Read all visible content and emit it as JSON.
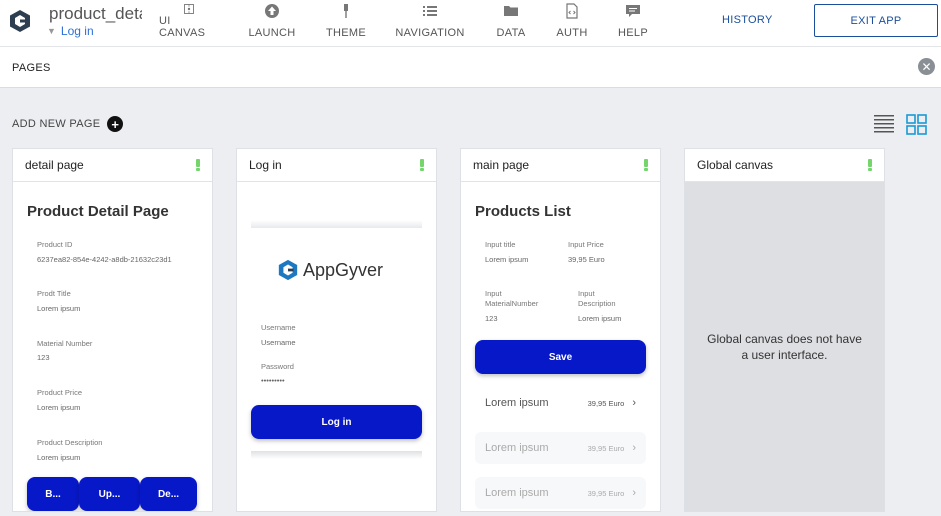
{
  "app": {
    "name": "product_detail",
    "status_link": "Log in",
    "logo_icon": "appgyver-logo-icon"
  },
  "nav": [
    {
      "label": "UI CANVAS",
      "icon": "ui-canvas-icon"
    },
    {
      "label": "LAUNCH",
      "icon": "launch-icon"
    },
    {
      "label": "THEME",
      "icon": "theme-brush-icon"
    },
    {
      "label": "NAVIGATION",
      "icon": "navigation-list-icon"
    },
    {
      "label": "DATA",
      "icon": "folder-icon"
    },
    {
      "label": "AUTH",
      "icon": "auth-document-icon"
    },
    {
      "label": "HELP",
      "icon": "help-chat-icon"
    }
  ],
  "header_actions": {
    "history": "HISTORY",
    "exit": "EXIT APP"
  },
  "pages_bar": {
    "title": "PAGES",
    "close_icon": "close-icon"
  },
  "toolbar": {
    "add_page": "ADD NEW PAGE",
    "list_view_icon": "list-view-icon",
    "grid_view_icon": "grid-view-icon"
  },
  "status_color": "#72d66a",
  "accent_color": "#0718c8",
  "pages": {
    "detail": {
      "name": "detail page",
      "title": "Product Detail Page",
      "fields": [
        {
          "label": "Product ID",
          "value": "6237ea82-854e-4242-a8db-21632c23d1"
        },
        {
          "label": "Prodt Title",
          "value": "Lorem ipsum"
        },
        {
          "label": "Material Number",
          "value": "123"
        },
        {
          "label": "Product Price",
          "value": "Lorem ipsum"
        },
        {
          "label": "Product Description",
          "value": "Lorem ipsum"
        }
      ],
      "buttons": [
        "B...",
        "Up...",
        "De..."
      ]
    },
    "login": {
      "name": "Log in",
      "brand": "AppGyver",
      "username_label": "Username",
      "username_value": "Username",
      "password_label": "Password",
      "password_value": "•••••••••",
      "button": "Log in"
    },
    "main": {
      "name": "main page",
      "title": "Products List",
      "inputs": [
        {
          "label": "Input title",
          "value": "Lorem ipsum"
        },
        {
          "label": "Input Price",
          "value": "39,95 Euro"
        },
        {
          "label": "Input MaterialNumber",
          "value": "123"
        },
        {
          "label": "Input Description",
          "value": "Lorem ipsum"
        }
      ],
      "save_button": "Save",
      "list": [
        {
          "title": "Lorem ipsum",
          "price": "39,95 Euro"
        },
        {
          "title": "Lorem ipsum",
          "price": "39,95 Euro"
        },
        {
          "title": "Lorem ipsum",
          "price": "39,95 Euro"
        }
      ]
    },
    "global": {
      "name": "Global canvas",
      "message_line1": "Global canvas does not have",
      "message_line2": "a user interface."
    }
  }
}
